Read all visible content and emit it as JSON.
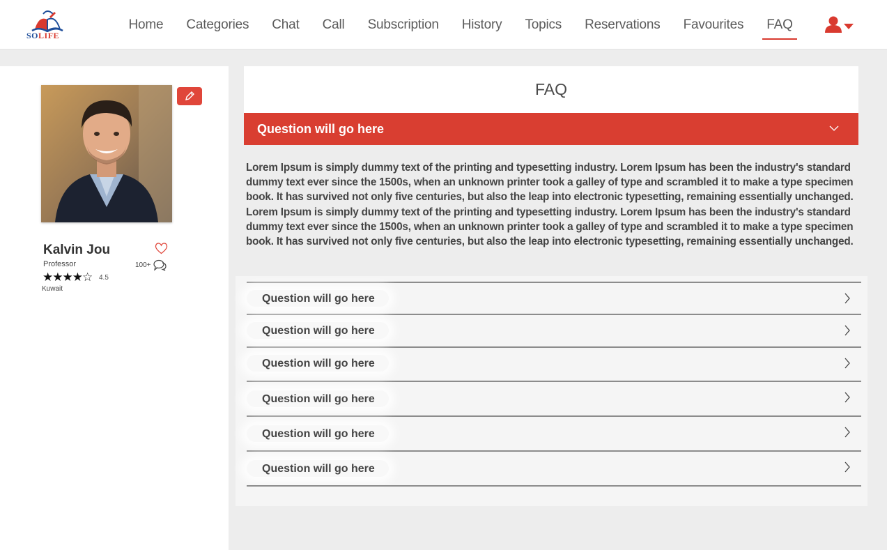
{
  "colors": {
    "accent": "#d93e31",
    "logo_blue": "#1f4e9a"
  },
  "header": {
    "logo_text_blue": "SO",
    "logo_text_red": "LIFE",
    "nav": [
      {
        "label": "Home"
      },
      {
        "label": "Categories"
      },
      {
        "label": "Chat"
      },
      {
        "label": "Call"
      },
      {
        "label": "Subscription"
      },
      {
        "label": "History"
      },
      {
        "label": "Topics"
      },
      {
        "label": "Reservations"
      },
      {
        "label": "Favourites"
      },
      {
        "label": "FAQ",
        "active": true
      }
    ],
    "user_icon": "user-icon",
    "user_caret_icon": "caret-down-icon"
  },
  "profile": {
    "name": "Kalvin Jou",
    "role": "Professor",
    "rating_stars": "★★★★☆",
    "rating": "4.5",
    "message_count": "100+",
    "location": "Kuwait",
    "edit_icon": "pencil-icon",
    "favourite_icon": "heart-icon",
    "message_icon": "chat-bubbles-icon"
  },
  "faq": {
    "title": "FAQ",
    "open_question": "Question will go here",
    "open_answer": "Lorem Ipsum is simply dummy text of the printing and typesetting industry. Lorem Ipsum has been the industry's standard dummy text ever since the 1500s, when an unknown printer took a galley of type and scrambled it to make a type specimen book. It has survived not only five centuries, but also the leap into electronic typesetting, remaining essentially unchanged. Lorem Ipsum is simply dummy text of the printing and typesetting industry. Lorem Ipsum has been the industry's standard dummy text ever since the 1500s, when an unknown printer took a galley of type and scrambled it to make a type specimen book. It has survived not only five centuries, but also the leap into electronic typesetting, remaining essentially unchanged.",
    "questions": [
      "Question will go here",
      "Question will go here",
      "Question will go here",
      "Question will go here",
      "Question will go here",
      "Question will go here"
    ]
  }
}
